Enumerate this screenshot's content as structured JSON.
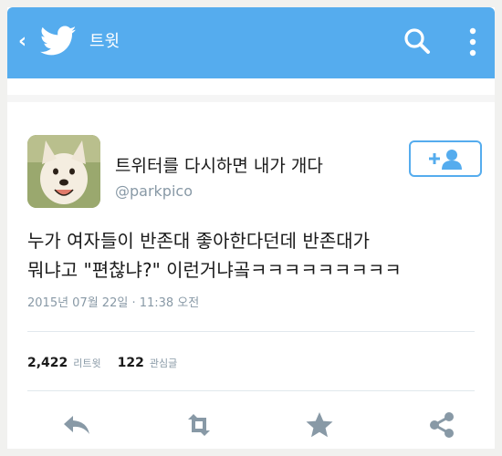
{
  "header": {
    "title": "트윗",
    "back_icon": "chevron-left-icon",
    "logo_icon": "twitter-bird-icon",
    "search_icon": "search-icon",
    "more_icon": "more-vertical-icon",
    "color": "#55acee"
  },
  "tweet": {
    "display_name": "트위터를 다시하면 내가 개다",
    "username": "@parkpico",
    "text_lines": [
      "누가 여자들이 반존대 좋아한다던데 반존대가",
      "뭐냐고 \"편찮냐?\" 이런거냐곸ㅋㅋㅋㅋㅋㅋㅋㅋㅋ"
    ],
    "timestamp": "2015년 07월 22일 · 11:38 오전",
    "follow_icon": "add-user-icon"
  },
  "stats": {
    "retweets_count": "2,422",
    "retweets_label": "리트윗",
    "likes_count": "122",
    "likes_label": "관심글"
  },
  "actions": [
    {
      "icon": "reply-icon"
    },
    {
      "icon": "retweet-icon"
    },
    {
      "icon": "star-icon"
    },
    {
      "icon": "share-icon"
    }
  ],
  "colors": {
    "accent": "#55acee",
    "muted_text": "#8899a6",
    "action_icon": "#8899a6"
  }
}
